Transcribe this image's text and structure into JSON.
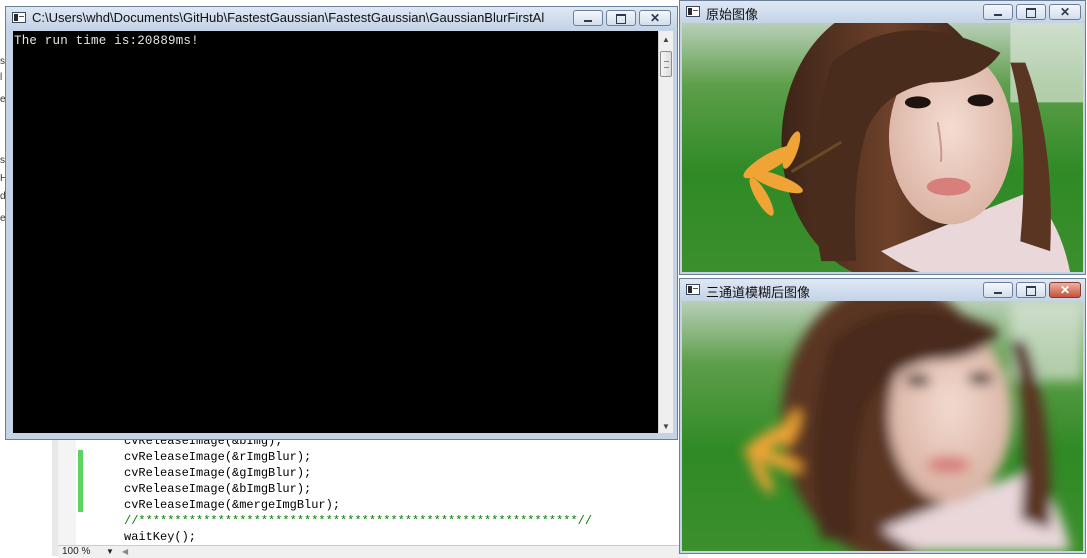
{
  "left_strip": {
    "chars": [
      "s",
      "l",
      "e",
      "s",
      "H",
      "d",
      "e"
    ]
  },
  "editor": {
    "lines": [
      "cvReleaseImage(&bImg);",
      "cvReleaseImage(&rImgBlur);",
      "cvReleaseImage(&gImgBlur);",
      "cvReleaseImage(&bImgBlur);",
      "cvReleaseImage(&mergeImgBlur);",
      "//*************************************************************//",
      "waitKey();"
    ],
    "zoom": "100 %"
  },
  "console": {
    "title": "C:\\Users\\whd\\Documents\\GitHub\\FastestGaussian\\FastestGaussian\\GaussianBlurFirstAlgori...",
    "output": "The run time is:20889ms!"
  },
  "original_window": {
    "title": "原始图像",
    "image": "portrait-photo-original"
  },
  "blurred_window": {
    "title": "三通道模糊后图像",
    "image": "portrait-photo-blurred"
  },
  "icons": {
    "minimize": "minimize-icon",
    "maximize": "maximize-icon",
    "close": "close-icon",
    "console": "console-icon",
    "window": "window-icon"
  },
  "colors": {
    "console_bg": "#000000",
    "titlebar": "#c4d3e6",
    "close_button": "#c8513a",
    "code_comment": "#008000",
    "change_marker": "#5fd35f"
  }
}
